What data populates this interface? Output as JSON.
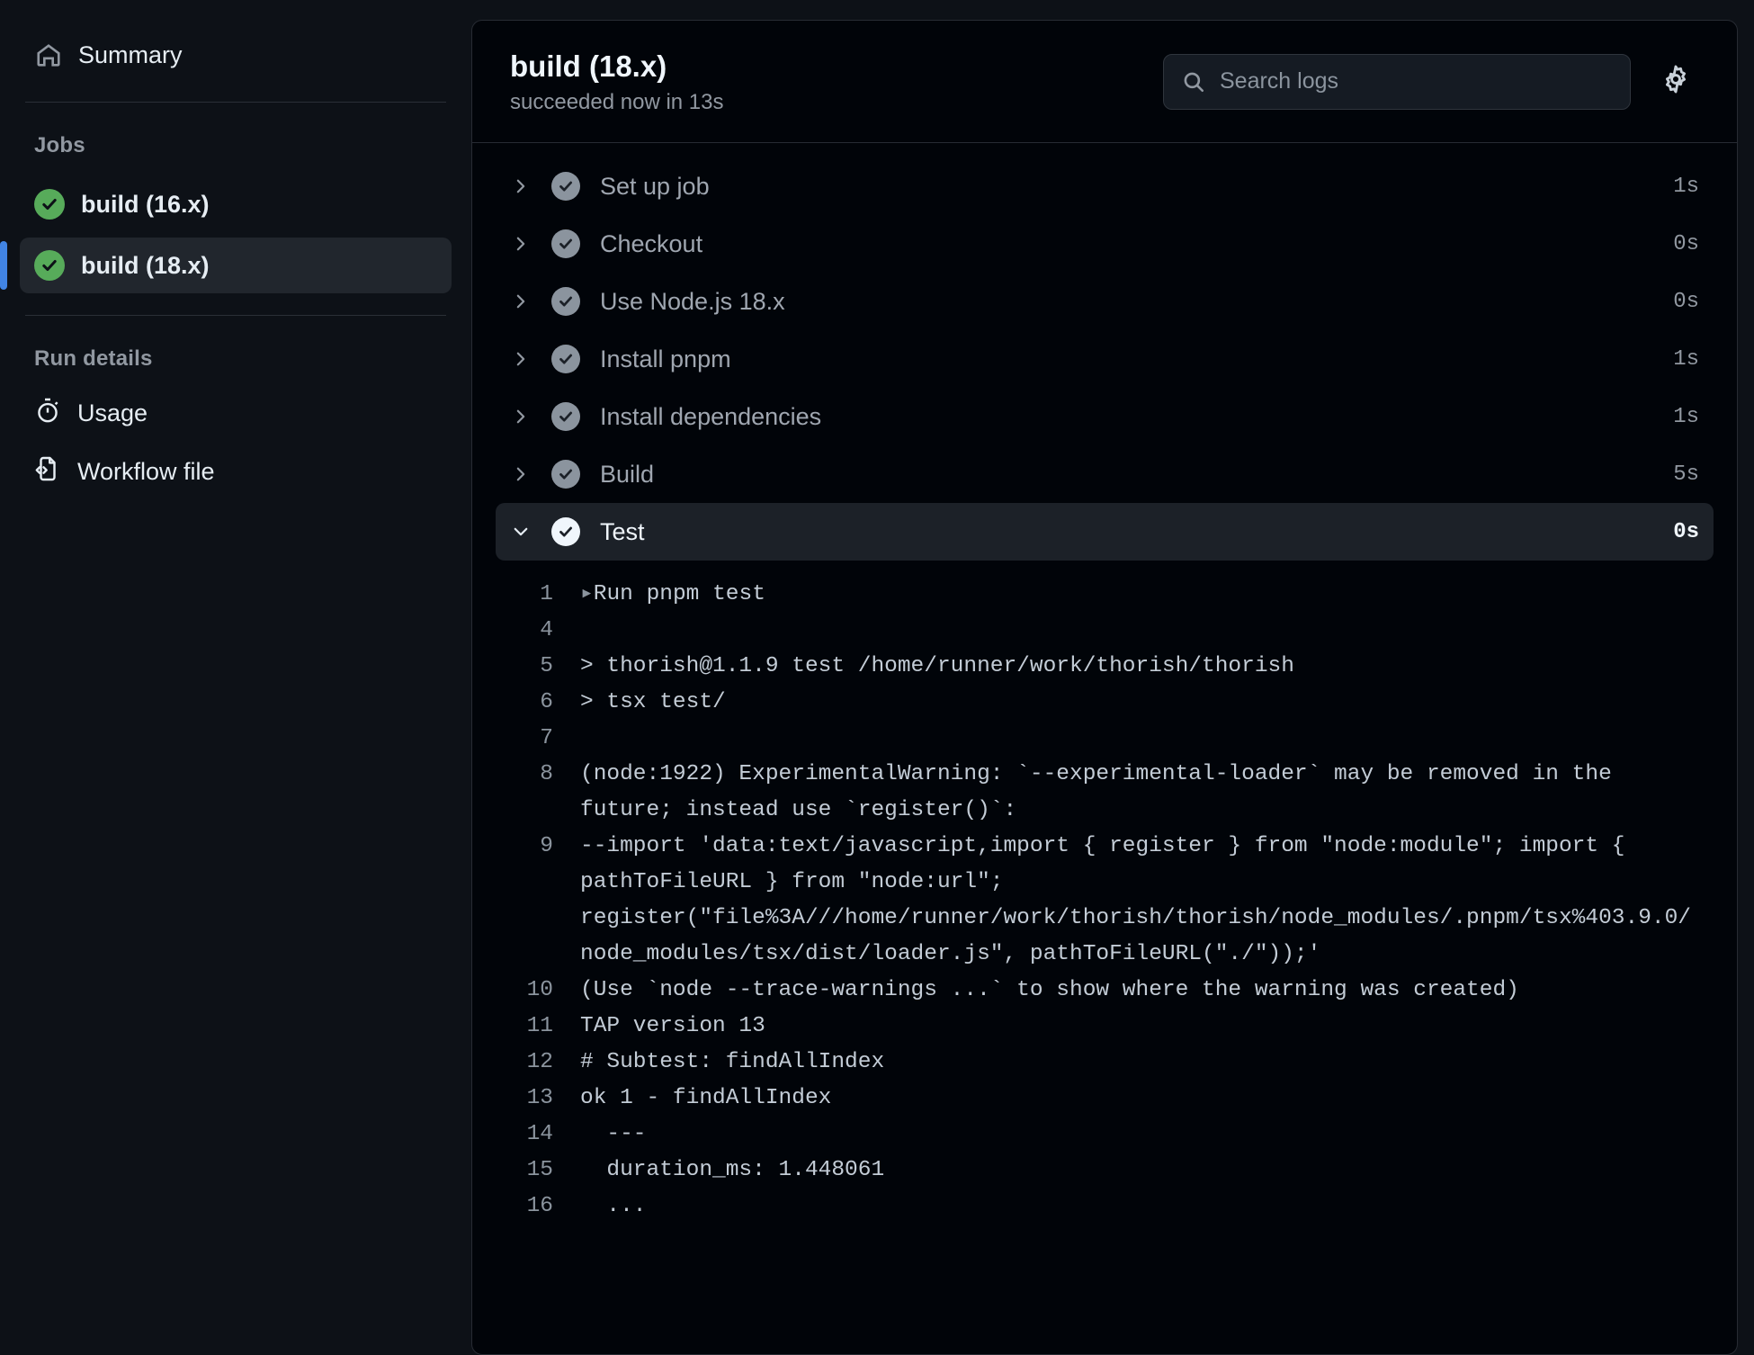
{
  "sidebar": {
    "summary": {
      "label": "Summary",
      "icon": "home-icon"
    },
    "jobs_heading": "Jobs",
    "jobs": [
      {
        "label": "build (16.x)",
        "status_icon": "check-circle-green-icon",
        "selected": false
      },
      {
        "label": "build (18.x)",
        "status_icon": "check-circle-green-icon",
        "selected": true
      }
    ],
    "run_details_heading": "Run details",
    "run_details": [
      {
        "label": "Usage",
        "icon": "stopwatch-icon"
      },
      {
        "label": "Workflow file",
        "icon": "file-code-icon"
      }
    ]
  },
  "header": {
    "title": "build (18.x)",
    "subtitle": "succeeded now in 13s",
    "search": {
      "placeholder": "Search logs",
      "value": "",
      "icon": "search-icon"
    },
    "settings_icon": "gear-icon"
  },
  "steps": [
    {
      "name": "Set up job",
      "duration": "1s",
      "expanded": false,
      "status": "success"
    },
    {
      "name": "Checkout",
      "duration": "0s",
      "expanded": false,
      "status": "success"
    },
    {
      "name": "Use Node.js 18.x",
      "duration": "0s",
      "expanded": false,
      "status": "success"
    },
    {
      "name": "Install pnpm",
      "duration": "1s",
      "expanded": false,
      "status": "success"
    },
    {
      "name": "Install dependencies",
      "duration": "1s",
      "expanded": false,
      "status": "success"
    },
    {
      "name": "Build",
      "duration": "5s",
      "expanded": false,
      "status": "success"
    },
    {
      "name": "Test",
      "duration": "0s",
      "expanded": true,
      "status": "success"
    }
  ],
  "log": {
    "lines": [
      {
        "num": "1",
        "text": "Run pnpm test",
        "marker": "▸"
      },
      {
        "num": "4",
        "text": ""
      },
      {
        "num": "5",
        "text": "> thorish@1.1.9 test /home/runner/work/thorish/thorish"
      },
      {
        "num": "6",
        "text": "> tsx test/"
      },
      {
        "num": "7",
        "text": ""
      },
      {
        "num": "8",
        "text": "(node:1922) ExperimentalWarning: `--experimental-loader` may be removed in the future; instead use `register()`:"
      },
      {
        "num": "9",
        "text": "--import 'data:text/javascript,import { register } from \"node:module\"; import { pathToFileURL } from \"node:url\";\nregister(\"file%3A///home/runner/work/thorish/thorish/node_modules/.pnpm/tsx%403.9.0/node_modules/tsx/dist/loader.js\", pathToFileURL(\"./\"));'"
      },
      {
        "num": "10",
        "text": "(Use `node --trace-warnings ...` to show where the warning was created)"
      },
      {
        "num": "11",
        "text": "TAP version 13"
      },
      {
        "num": "12",
        "text": "# Subtest: findAllIndex"
      },
      {
        "num": "13",
        "text": "ok 1 - findAllIndex"
      },
      {
        "num": "14",
        "text": "  ---"
      },
      {
        "num": "15",
        "text": "  duration_ms: 1.448061"
      },
      {
        "num": "16",
        "text": "  ..."
      }
    ]
  },
  "colors": {
    "page_background": "#0d1117",
    "panel_background": "#010409",
    "accent_blue": "#4184e4",
    "success_green": "#57ab5a",
    "muted_text": "#9198a1"
  }
}
